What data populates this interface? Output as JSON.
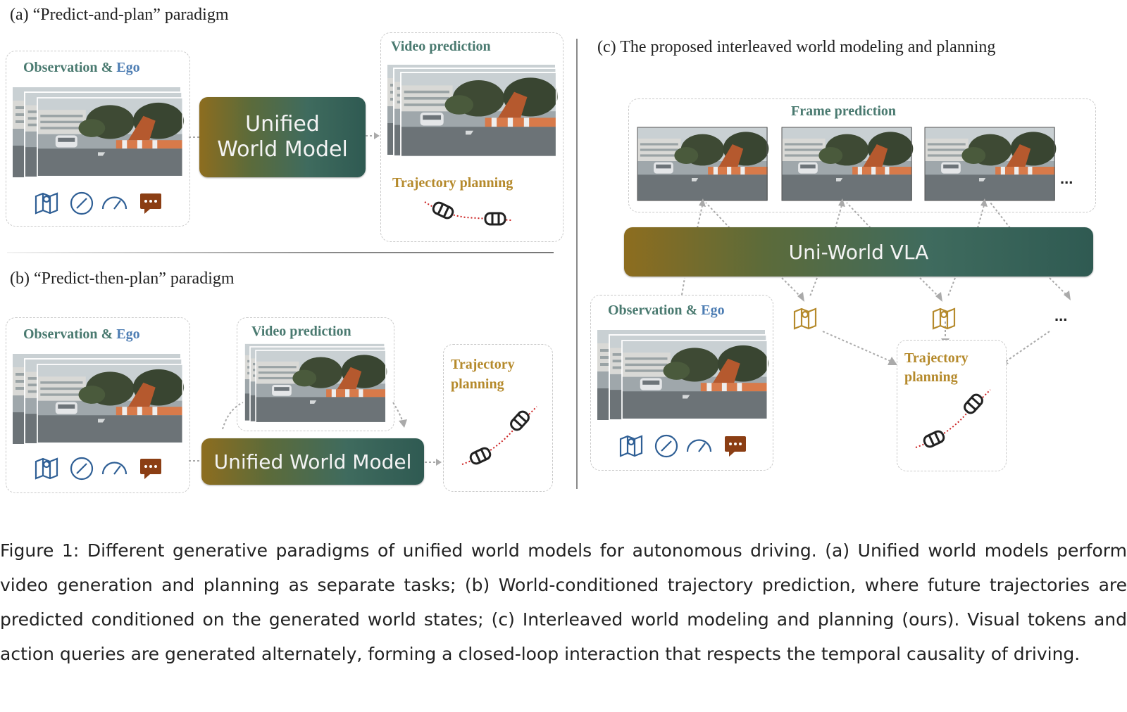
{
  "panel_a": {
    "title": "(a) “Predict-and-plan” paradigm",
    "obs_label": "Observation",
    "amp": "&",
    "ego_label": "Ego",
    "model": "Unified World Model",
    "model_line1": "Unified",
    "model_line2": "World Model",
    "video_label": "Video prediction",
    "traj_label": "Trajectory planning"
  },
  "panel_b": {
    "title": "(b) “Predict-then-plan” paradigm",
    "obs_label": "Observation",
    "amp": "&",
    "ego_label": "Ego",
    "video_label": "Video prediction",
    "model": "Unified World Model",
    "traj_line1": "Trajectory",
    "traj_line2": "planning"
  },
  "panel_c": {
    "title": "(c) The proposed interleaved world modeling and planning",
    "frame_label": "Frame prediction",
    "model": "Uni-World VLA",
    "obs_label": "Observation",
    "amp": "&",
    "ego_label": "Ego",
    "traj_line1": "Trajectory",
    "traj_line2": "planning",
    "ellipsis": "..."
  },
  "icons": [
    "map-icon",
    "compass-icon",
    "speedometer-icon",
    "chat-icon"
  ],
  "colors": {
    "teal": "#4a7a70",
    "ego_blue": "#4d7db3",
    "gold": "#b58a2c",
    "chat_brown": "#8b3e14",
    "icon_blue": "#2f5f95"
  },
  "caption": "Figure 1: Different generative paradigms of unified world models for autonomous driving. (a) Unified world models perform video generation and planning as separate tasks; (b) World-conditioned trajectory prediction, where future trajectories are predicted conditioned on the generated world states; (c) Interleaved world modeling and planning (ours). Visual tokens and action queries are generated alternately, forming a closed-loop interaction that respects the temporal causality of driving."
}
